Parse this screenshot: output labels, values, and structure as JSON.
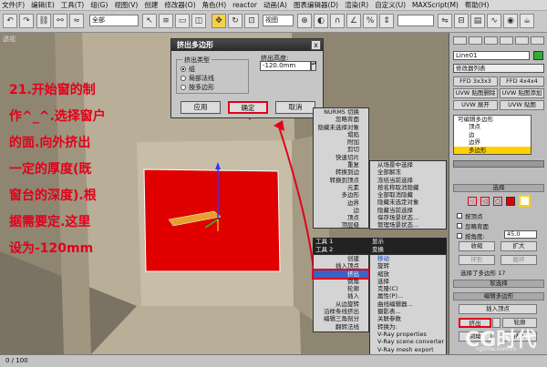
{
  "menubar": [
    "文件(F)",
    "编辑(E)",
    "工具(T)",
    "组(G)",
    "视图(V)",
    "创建",
    "修改器(O)",
    "角色(H)",
    "reactor",
    "动画(A)",
    "图表编辑器(D)",
    "渲染(R)",
    "自定义(U)",
    "MAXScript(M)",
    "帮助(H)"
  ],
  "toolbar": {
    "filter_value": "全部",
    "view_value": "视图",
    "selection_set": ""
  },
  "viewport": {
    "label": "透视"
  },
  "annotation": [
    "21.开始窗的制",
    "作^_^.选择窗户",
    "的面.向外挤出",
    "一定的厚度(既",
    "窗台的深度).根",
    "据需要定.这里",
    "设为-120mm"
  ],
  "dialog": {
    "title": "挤出多边形",
    "close": "x",
    "group_type": "挤出类型",
    "radio_group": "组",
    "radio_local": "局部法线",
    "radio_poly": "按多边形",
    "height_label": "挤出高度:",
    "height_value": "-120.0mm",
    "apply": "应用",
    "ok": "确定",
    "cancel": "取消"
  },
  "quad": {
    "left_items": [
      "NURMS 切换",
      "忽略背面",
      "隐藏未选择对象",
      "塌陷",
      "附加",
      "剪切",
      "快速切片",
      "重复",
      "转换到边",
      "转换到顶点",
      "元素",
      "多边形",
      "边界",
      "边",
      "顶点",
      "顶层级"
    ],
    "right_items": [
      "从场景中选择",
      "全部解冻",
      "冻结当前选择",
      "按名称取消隐藏",
      "全部取消隐藏",
      "隐藏未选定对象",
      "隐藏当前选择",
      "保存场景状态...",
      "管理场景状态..."
    ],
    "head_tools1": "工具 1",
    "head_tools2": "工具 2",
    "head_display": "显示",
    "head_transform": "变换",
    "bottom_left": [
      "创建",
      "插入顶点",
      "挤出",
      "倒角",
      "轮廓",
      "插入",
      "从边旋转",
      "沿样条线挤出",
      "编辑三角剖分",
      "翻转法线"
    ],
    "bottom_right": [
      "移动",
      "旋转",
      "缩放",
      "选择",
      "克隆(C)",
      "属性(P)...",
      "曲线编辑器...",
      "摄影表...",
      "关联参数",
      "转换为:",
      "V-Ray properties",
      "V-Ray scene converter",
      "V-Ray mesh export",
      "V-Ray VFB"
    ],
    "check": "✓"
  },
  "cmdpanel": {
    "object_name": "Line01",
    "modifier_list": "修改器列表",
    "mod_btns": [
      "FFD 3x3x3",
      "FFD 4x4x4",
      "UVW 贴图删除",
      "UVW 贴图添加",
      "UVW 展开",
      "UVW 贴图"
    ],
    "stack": [
      "可编辑多边形",
      "顶点",
      "边",
      "边界",
      "多边形"
    ],
    "selection_title": "选择",
    "by_vertex": "按顶点",
    "ignore_back": "忽略背面",
    "by_angle": "按角度:",
    "angle_value": "45.0",
    "shrink": "收缩",
    "grow": "扩大",
    "ring": "环形",
    "loop": "循环",
    "selected_info": "选择了多边形 17",
    "soft_sel": "软选择",
    "edit_poly": "编辑多边形",
    "insert_vertex": "插入顶点",
    "extrude": "挤出",
    "outline": "轮廓",
    "bevel": "倒角",
    "inset": "插入"
  },
  "status": {
    "frames": "0 / 100"
  },
  "watermark": {
    "main": "CG时代",
    "sub": "cgtime.com.cn"
  },
  "colors": {
    "accent": "#e2001a",
    "face": "#e00000",
    "selection": "#ffd000"
  }
}
